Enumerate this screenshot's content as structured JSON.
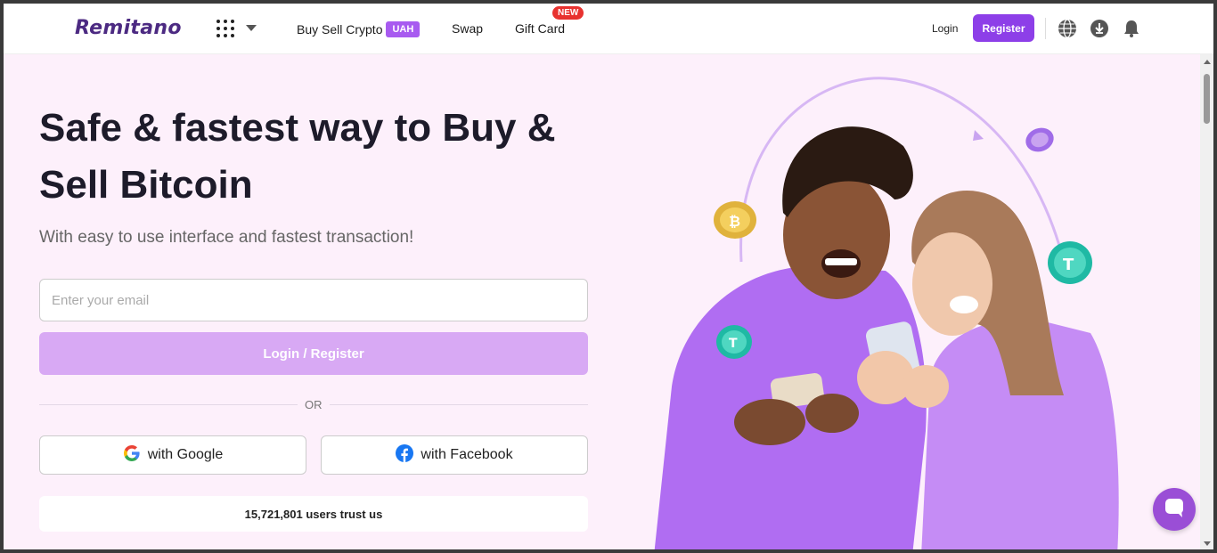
{
  "header": {
    "logo_text": "Remitano",
    "nav": {
      "buy_sell": "Buy Sell Crypto",
      "currency_badge": "UAH",
      "swap": "Swap",
      "gift_card": "Gift Card",
      "new_badge": "NEW"
    },
    "login": "Login",
    "register": "Register"
  },
  "hero": {
    "title": "Safe & fastest way to Buy & Sell Bitcoin",
    "subtitle": "With easy to use interface and fastest transaction!",
    "email_placeholder": "Enter your email",
    "login_register": "Login / Register",
    "or": "OR",
    "google": "with Google",
    "facebook": "with Facebook",
    "trust": "15,721,801 users trust us"
  },
  "colors": {
    "brand": "#8d3fe8",
    "hero_bg": "#fdf0fb",
    "button_disabled": "#d8a9f4",
    "new_badge": "#e8322f"
  }
}
